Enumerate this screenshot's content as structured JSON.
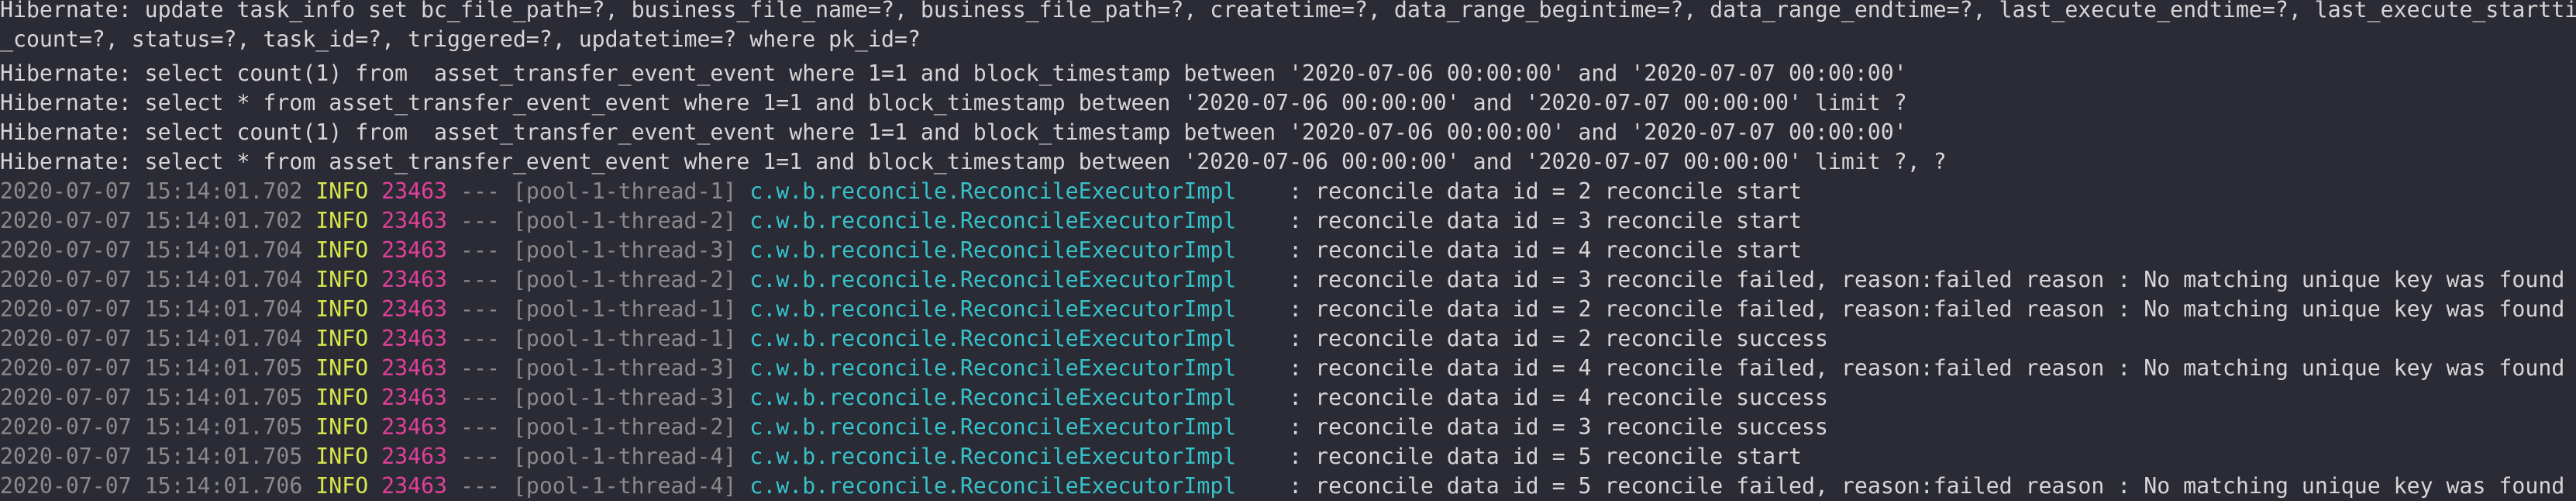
{
  "terminal": {
    "hibernate_lines": [
      "Hibernate: update task_info set bc_file_path=?, business_file_name=?, business_file_path=?, createtime=?, data_range_begintime=?, data_range_endtime=?, last_execute_endtime=?, last_execute_starttime=?, node_",
      "_count=?, status=?, task_id=?, triggered=?, updatetime=? where pk_id=?",
      "Hibernate: select count(1) from  asset_transfer_event_event where 1=1 and block_timestamp between '2020-07-06 00:00:00' and '2020-07-07 00:00:00'",
      "Hibernate: select * from asset_transfer_event_event where 1=1 and block_timestamp between '2020-07-06 00:00:00' and '2020-07-07 00:00:00' limit ?",
      "Hibernate: select count(1) from  asset_transfer_event_event where 1=1 and block_timestamp between '2020-07-06 00:00:00' and '2020-07-07 00:00:00'",
      "Hibernate: select * from asset_transfer_event_event where 1=1 and block_timestamp between '2020-07-06 00:00:00' and '2020-07-07 00:00:00' limit ?, ?"
    ],
    "log_lines": [
      {
        "ts": "2020-07-07 15:14:01.702",
        "level": " INFO",
        "pid": "23463",
        "sep": " --- ",
        "thread": "[pool-1-thread-1]",
        "logger": "c.w.b.reconcile.ReconcileExecutorImpl",
        "colon": "    : ",
        "msg": "reconcile data id = 2 reconcile start"
      },
      {
        "ts": "2020-07-07 15:14:01.702",
        "level": " INFO",
        "pid": "23463",
        "sep": " --- ",
        "thread": "[pool-1-thread-2]",
        "logger": "c.w.b.reconcile.ReconcileExecutorImpl",
        "colon": "    : ",
        "msg": "reconcile data id = 3 reconcile start"
      },
      {
        "ts": "2020-07-07 15:14:01.704",
        "level": " INFO",
        "pid": "23463",
        "sep": " --- ",
        "thread": "[pool-1-thread-3]",
        "logger": "c.w.b.reconcile.ReconcileExecutorImpl",
        "colon": "    : ",
        "msg": "reconcile data id = 4 reconcile start"
      },
      {
        "ts": "2020-07-07 15:14:01.704",
        "level": " INFO",
        "pid": "23463",
        "sep": " --- ",
        "thread": "[pool-1-thread-2]",
        "logger": "c.w.b.reconcile.ReconcileExecutorImpl",
        "colon": "    : ",
        "msg": "reconcile data id = 3 reconcile failed, reason:failed reason : No matching unique key was found"
      },
      {
        "ts": "2020-07-07 15:14:01.704",
        "level": " INFO",
        "pid": "23463",
        "sep": " --- ",
        "thread": "[pool-1-thread-1]",
        "logger": "c.w.b.reconcile.ReconcileExecutorImpl",
        "colon": "    : ",
        "msg": "reconcile data id = 2 reconcile failed, reason:failed reason : No matching unique key was found"
      },
      {
        "ts": "2020-07-07 15:14:01.704",
        "level": " INFO",
        "pid": "23463",
        "sep": " --- ",
        "thread": "[pool-1-thread-1]",
        "logger": "c.w.b.reconcile.ReconcileExecutorImpl",
        "colon": "    : ",
        "msg": "reconcile data id = 2 reconcile success"
      },
      {
        "ts": "2020-07-07 15:14:01.705",
        "level": " INFO",
        "pid": "23463",
        "sep": " --- ",
        "thread": "[pool-1-thread-3]",
        "logger": "c.w.b.reconcile.ReconcileExecutorImpl",
        "colon": "    : ",
        "msg": "reconcile data id = 4 reconcile failed, reason:failed reason : No matching unique key was found"
      },
      {
        "ts": "2020-07-07 15:14:01.705",
        "level": " INFO",
        "pid": "23463",
        "sep": " --- ",
        "thread": "[pool-1-thread-3]",
        "logger": "c.w.b.reconcile.ReconcileExecutorImpl",
        "colon": "    : ",
        "msg": "reconcile data id = 4 reconcile success"
      },
      {
        "ts": "2020-07-07 15:14:01.705",
        "level": " INFO",
        "pid": "23463",
        "sep": " --- ",
        "thread": "[pool-1-thread-2]",
        "logger": "c.w.b.reconcile.ReconcileExecutorImpl",
        "colon": "    : ",
        "msg": "reconcile data id = 3 reconcile success"
      },
      {
        "ts": "2020-07-07 15:14:01.705",
        "level": " INFO",
        "pid": "23463",
        "sep": " --- ",
        "thread": "[pool-1-thread-4]",
        "logger": "c.w.b.reconcile.ReconcileExecutorImpl",
        "colon": "    : ",
        "msg": "reconcile data id = 5 reconcile start"
      },
      {
        "ts": "2020-07-07 15:14:01.706",
        "level": " INFO",
        "pid": "23463",
        "sep": " --- ",
        "thread": "[pool-1-thread-4]",
        "logger": "c.w.b.reconcile.ReconcileExecutorImpl",
        "colon": "    : ",
        "msg": "reconcile data id = 5 reconcile failed, reason:failed reason : No matching unique key was found"
      }
    ]
  },
  "colors": {
    "background": "#2b2b36",
    "text": "#d6d6d6",
    "timestamp": "#8a8a8a",
    "level": "#d8e84c",
    "pid": "#e0409a",
    "logger": "#36c3c9"
  }
}
